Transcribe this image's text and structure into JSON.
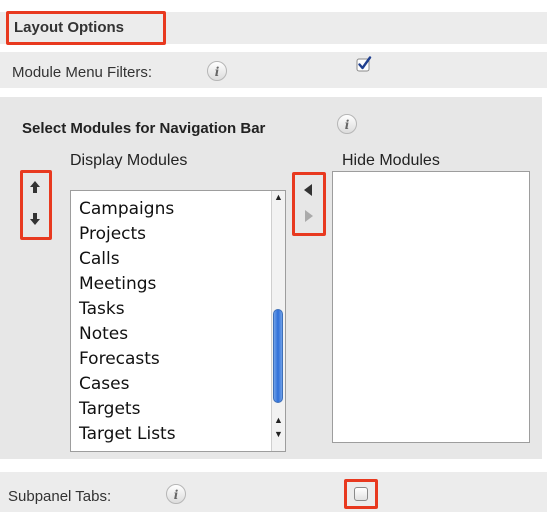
{
  "layout": {
    "title": "Layout Options"
  },
  "module_menu": {
    "label": "Module Menu Filters:",
    "checked": true
  },
  "nav": {
    "title": "Select Modules for Navigation Bar",
    "display_header": "Display Modules",
    "hide_header": "Hide Modules",
    "display_items": [
      "Campaigns",
      "Projects",
      "Calls",
      "Meetings",
      "Tasks",
      "Notes",
      "Forecasts",
      "Cases",
      "Targets",
      "Target Lists"
    ],
    "hide_items": []
  },
  "subpanel": {
    "label": "Subpanel Tabs:",
    "checked": false
  },
  "colors": {
    "highlight": "#e8391f",
    "strip": "#ececec",
    "panel": "#e7e7e7",
    "scroll_thumb": "#2f6fd8"
  },
  "icons": {
    "info": "info-icon",
    "move_up": "arrow-up-icon",
    "move_down": "arrow-down-icon",
    "move_left": "arrow-left-icon",
    "move_right": "arrow-right-icon"
  }
}
